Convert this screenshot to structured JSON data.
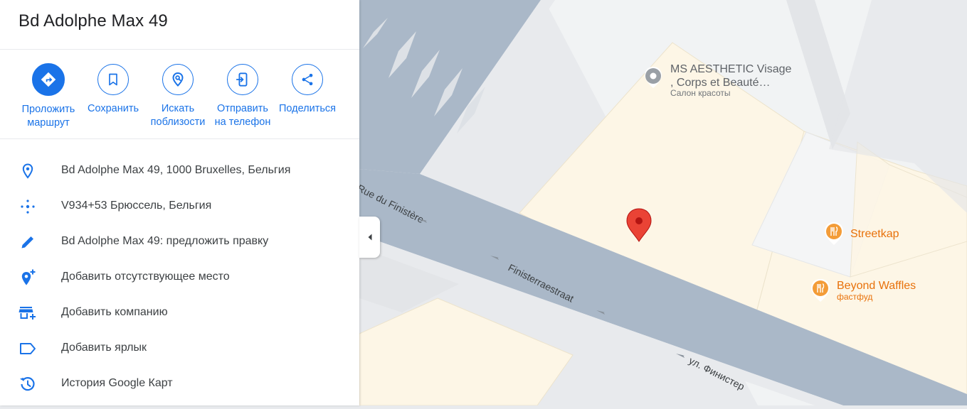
{
  "place": {
    "title": "Bd Adolphe Max 49"
  },
  "actions": [
    {
      "line1": "Проложить",
      "line2": "маршрут",
      "icon": "directions-icon"
    },
    {
      "line1": "Сохранить",
      "line2": "",
      "icon": "bookmark-icon"
    },
    {
      "line1": "Искать",
      "line2": "поблизости",
      "icon": "nearby-search-icon"
    },
    {
      "line1": "Отправить",
      "line2": "на телефон",
      "icon": "send-to-phone-icon"
    },
    {
      "line1": "Поделиться",
      "line2": "",
      "icon": "share-icon"
    }
  ],
  "info_rows": [
    {
      "text": "Bd Adolphe Max 49, 1000 Bruxelles, Бельгия",
      "icon": "location-pin-icon"
    },
    {
      "text": "V934+53 Брюссель, Бельгия",
      "icon": "plus-code-icon"
    },
    {
      "text": "Bd Adolphe Max 49: предложить правку",
      "icon": "pencil-icon"
    },
    {
      "text": "Добавить отсутствующее место",
      "icon": "add-place-icon"
    },
    {
      "text": "Добавить компанию",
      "icon": "add-business-icon"
    },
    {
      "text": "Добавить ярлык",
      "icon": "label-icon"
    },
    {
      "text": "История Google Карт",
      "icon": "history-icon"
    }
  ],
  "map": {
    "streets": {
      "street_fr": "Rue du Finistère",
      "street_nl": "Finisterraestraat",
      "street_ru": "ул. Финистер"
    },
    "pois": [
      {
        "name_line1": "MS AESTHETIC Visage",
        "name_line2": ", Corps et Beauté…",
        "category": "Салон красоты",
        "icon": "beauty-salon-pin-icon"
      },
      {
        "name_line1": "Streetkap",
        "category": "",
        "icon": "restaurant-pin-icon"
      },
      {
        "name_line1": "Beyond Waffles",
        "category": "фастфуд",
        "icon": "fastfood-pin-icon"
      }
    ]
  },
  "colors": {
    "accent": "#1a73e8",
    "road": "#aab8c8",
    "building": "#fdf6e6",
    "poi_orange": "#e8710a",
    "marker_red": "#ea4335"
  }
}
